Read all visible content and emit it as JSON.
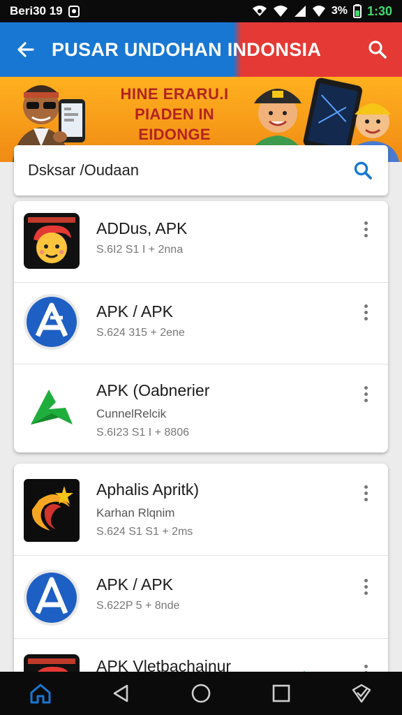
{
  "status_bar": {
    "time_left": "Beri30 19",
    "battery_text": "3%",
    "time_right": "1:30",
    "icons": [
      "notification-icon",
      "wifi-icon",
      "signal-icon",
      "battery-icon"
    ]
  },
  "app_bar": {
    "title": "PUSAR UNDOHAN INDONSIA",
    "colors": {
      "left": "#1877d2",
      "right": "#e53935"
    }
  },
  "banner": {
    "line1": "HINE ERARU.I",
    "line2": "PIADEN IN EIDONGE"
  },
  "search": {
    "value": "Dsksar /Oudaan"
  },
  "apps_group_1": [
    {
      "name": "ADDus, APK",
      "sub": "",
      "meta": "S.6I2 S1 I + 2nna",
      "icon": "mascot-face-icon"
    },
    {
      "name": "APK / APK",
      "sub": "",
      "meta": "S.624 315 + 2ene",
      "icon": "apk-store-icon"
    },
    {
      "name": "APK (Oabnerier",
      "sub": "CunnelRelcik",
      "meta": "S.6I23 S1 I + 8806",
      "icon": "green-arrow-icon"
    }
  ],
  "apps_group_2": [
    {
      "name": "Aphalis Apritk)",
      "sub": "Karhan Rlqnim",
      "meta": "S.624 S1 S1 + 2ms",
      "icon": "crescent-star-icon"
    },
    {
      "name": "APK / APK",
      "sub": "",
      "meta": "S.622P 5 + 8nde",
      "icon": "apk-store-icon"
    },
    {
      "name": "APK Vletbachainur",
      "sub": "",
      "meta": "",
      "icon": "mascot-face-icon"
    }
  ],
  "nav_bar": {
    "icons": [
      "home-icon",
      "back-triangle-icon",
      "home-circle-icon",
      "recents-square-icon",
      "check-icon"
    ]
  }
}
